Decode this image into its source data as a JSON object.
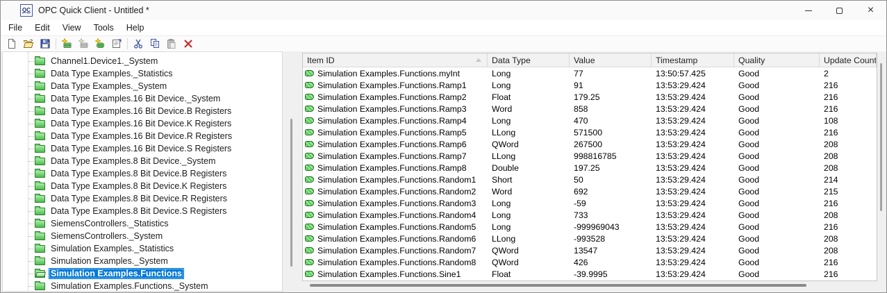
{
  "window": {
    "title": "OPC Quick Client - Untitled *",
    "app_icon_text": "QC"
  },
  "icons": {
    "close": "×",
    "sort_ascending": "triangle-up",
    "row_tag": "green-tag",
    "tree_folder": "green-folder"
  },
  "menu": {
    "items": [
      "File",
      "Edit",
      "View",
      "Tools",
      "Help"
    ]
  },
  "toolbar": {
    "buttons": [
      {
        "name": "new-file"
      },
      {
        "name": "open-file"
      },
      {
        "name": "save-file"
      },
      {
        "name": "new-server-connection"
      },
      {
        "name": "new-group",
        "disabled": true
      },
      {
        "name": "new-item"
      },
      {
        "name": "properties"
      },
      {
        "name": "cut"
      },
      {
        "name": "copy"
      },
      {
        "name": "paste",
        "disabled": true
      },
      {
        "name": "delete"
      }
    ]
  },
  "tree": {
    "items": [
      {
        "label": "Channel1.Device1._System",
        "selected": false
      },
      {
        "label": "Data Type Examples._Statistics",
        "selected": false
      },
      {
        "label": "Data Type Examples._System",
        "selected": false
      },
      {
        "label": "Data Type Examples.16 Bit Device._System",
        "selected": false
      },
      {
        "label": "Data Type Examples.16 Bit Device.B Registers",
        "selected": false
      },
      {
        "label": "Data Type Examples.16 Bit Device.K Registers",
        "selected": false
      },
      {
        "label": "Data Type Examples.16 Bit Device.R Registers",
        "selected": false
      },
      {
        "label": "Data Type Examples.16 Bit Device.S Registers",
        "selected": false
      },
      {
        "label": "Data Type Examples.8 Bit Device._System",
        "selected": false
      },
      {
        "label": "Data Type Examples.8 Bit Device.B Registers",
        "selected": false
      },
      {
        "label": "Data Type Examples.8 Bit Device.K Registers",
        "selected": false
      },
      {
        "label": "Data Type Examples.8 Bit Device.R Registers",
        "selected": false
      },
      {
        "label": "Data Type Examples.8 Bit Device.S Registers",
        "selected": false
      },
      {
        "label": "SiemensControllers._Statistics",
        "selected": false
      },
      {
        "label": "SiemensControllers._System",
        "selected": false
      },
      {
        "label": "Simulation Examples._Statistics",
        "selected": false
      },
      {
        "label": "Simulation Examples._System",
        "selected": false
      },
      {
        "label": "Simulation Examples.Functions",
        "selected": true
      },
      {
        "label": "Simulation Examples.Functions._System",
        "selected": false
      }
    ]
  },
  "table": {
    "columns": [
      "Item ID",
      "Data Type",
      "Value",
      "Timestamp",
      "Quality",
      "Update Count"
    ],
    "sorted_column": "Item ID",
    "rows": [
      {
        "item_id": "Simulation Examples.Functions.myInt",
        "data_type": "Long",
        "value": "77",
        "timestamp": "13:50:57.425",
        "quality": "Good",
        "update_count": "2"
      },
      {
        "item_id": "Simulation Examples.Functions.Ramp1",
        "data_type": "Long",
        "value": "91",
        "timestamp": "13:53:29.424",
        "quality": "Good",
        "update_count": "216"
      },
      {
        "item_id": "Simulation Examples.Functions.Ramp2",
        "data_type": "Float",
        "value": "179.25",
        "timestamp": "13:53:29.424",
        "quality": "Good",
        "update_count": "216"
      },
      {
        "item_id": "Simulation Examples.Functions.Ramp3",
        "data_type": "Word",
        "value": "858",
        "timestamp": "13:53:29.424",
        "quality": "Good",
        "update_count": "216"
      },
      {
        "item_id": "Simulation Examples.Functions.Ramp4",
        "data_type": "Long",
        "value": "470",
        "timestamp": "13:53:29.424",
        "quality": "Good",
        "update_count": "108"
      },
      {
        "item_id": "Simulation Examples.Functions.Ramp5",
        "data_type": "LLong",
        "value": "571500",
        "timestamp": "13:53:29.424",
        "quality": "Good",
        "update_count": "216"
      },
      {
        "item_id": "Simulation Examples.Functions.Ramp6",
        "data_type": "QWord",
        "value": "267500",
        "timestamp": "13:53:29.424",
        "quality": "Good",
        "update_count": "208"
      },
      {
        "item_id": "Simulation Examples.Functions.Ramp7",
        "data_type": "LLong",
        "value": "998816785",
        "timestamp": "13:53:29.424",
        "quality": "Good",
        "update_count": "208"
      },
      {
        "item_id": "Simulation Examples.Functions.Ramp8",
        "data_type": "Double",
        "value": "197.25",
        "timestamp": "13:53:29.424",
        "quality": "Good",
        "update_count": "208"
      },
      {
        "item_id": "Simulation Examples.Functions.Random1",
        "data_type": "Short",
        "value": "50",
        "timestamp": "13:53:29.424",
        "quality": "Good",
        "update_count": "214"
      },
      {
        "item_id": "Simulation Examples.Functions.Random2",
        "data_type": "Word",
        "value": "692",
        "timestamp": "13:53:29.424",
        "quality": "Good",
        "update_count": "215"
      },
      {
        "item_id": "Simulation Examples.Functions.Random3",
        "data_type": "Long",
        "value": "-59",
        "timestamp": "13:53:29.424",
        "quality": "Good",
        "update_count": "216"
      },
      {
        "item_id": "Simulation Examples.Functions.Random4",
        "data_type": "Long",
        "value": "733",
        "timestamp": "13:53:29.424",
        "quality": "Good",
        "update_count": "208"
      },
      {
        "item_id": "Simulation Examples.Functions.Random5",
        "data_type": "Long",
        "value": "-999969043",
        "timestamp": "13:53:29.424",
        "quality": "Good",
        "update_count": "216"
      },
      {
        "item_id": "Simulation Examples.Functions.Random6",
        "data_type": "LLong",
        "value": "-993528",
        "timestamp": "13:53:29.424",
        "quality": "Good",
        "update_count": "208"
      },
      {
        "item_id": "Simulation Examples.Functions.Random7",
        "data_type": "QWord",
        "value": "13547",
        "timestamp": "13:53:29.424",
        "quality": "Good",
        "update_count": "208"
      },
      {
        "item_id": "Simulation Examples.Functions.Random8",
        "data_type": "QWord",
        "value": "426",
        "timestamp": "13:53:29.424",
        "quality": "Good",
        "update_count": "216"
      },
      {
        "item_id": "Simulation Examples.Functions.Sine1",
        "data_type": "Float",
        "value": "-39.9995",
        "timestamp": "13:53:29.424",
        "quality": "Good",
        "update_count": "216"
      }
    ]
  },
  "colors": {
    "selection": "#0078d7",
    "selection_text": "#ffffff",
    "folder_green": "#4dbd4d",
    "tag_green": "#58c858",
    "delete_red": "#c92a2a",
    "scrollbar_thumb": "#a3a3a3",
    "hscroll_thumb": "#8a8a8a"
  }
}
